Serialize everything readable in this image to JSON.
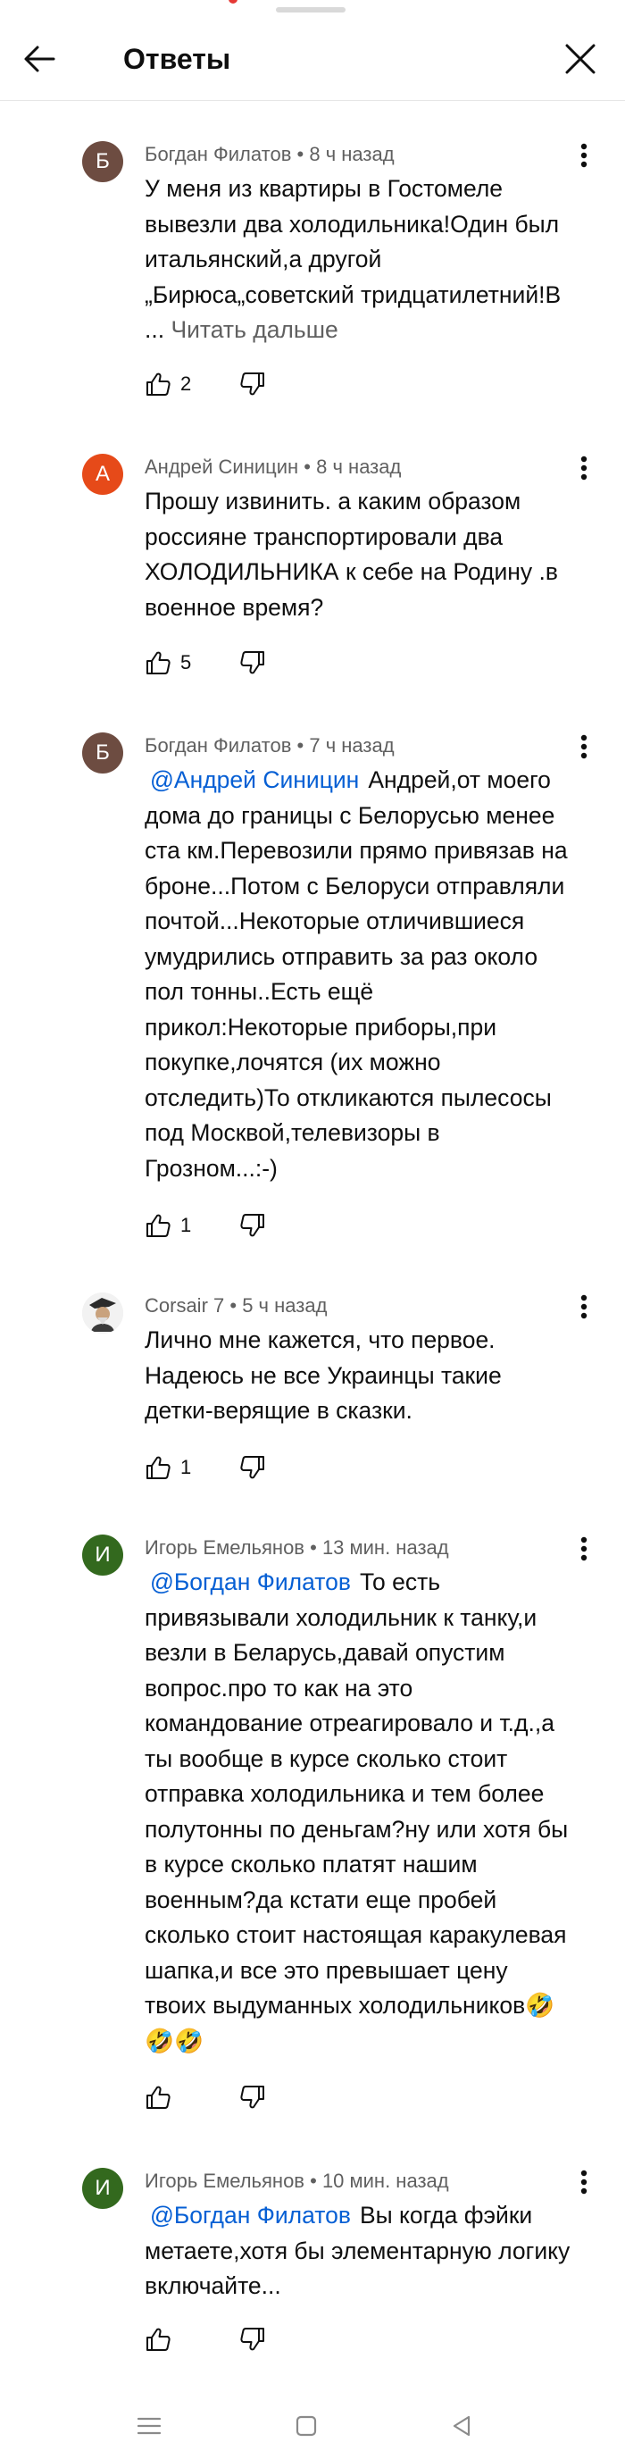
{
  "header": {
    "title": "Ответы"
  },
  "comments": [
    {
      "avatar_letter": "Б",
      "avatar_color": "#6d4c41",
      "author": "Богдан Филатов",
      "time": "8 ч назад",
      "mention": "",
      "text": "У меня из квартиры в Гостомеле вывезли два холодильника!Один был итальянский,а другой „Бирюса„советский тридцатилетний!В ...",
      "read_more": "Читать дальше",
      "likes": "2"
    },
    {
      "avatar_letter": "А",
      "avatar_color": "#e64a19",
      "author": "Андрей Синицин",
      "time": "8 ч назад",
      "mention": "",
      "text": "Прошу извинить. а каким образом россияне транспортировали два ХОЛОДИЛЬНИКА к себе на Родину .в военное время?",
      "read_more": "",
      "likes": "5"
    },
    {
      "avatar_letter": "Б",
      "avatar_color": "#6d4c41",
      "author": "Богдан Филатов",
      "time": "7 ч назад",
      "mention": "@Андрей Синицин",
      "text": "Андрей,от моего дома до границы с Белорусью менее ста км.Перевозили прямо привязав на броне...Потом с Белоруси отправляли почтой...Некоторые отличившиеся умудрились отправить за раз около пол тонны..Есть ещё прикол:Некоторые приборы,при покупке,лочятся (их можно отследить)То откликаются пылесосы под Москвой,телевизоры в Грозном...:-)",
      "read_more": "",
      "likes": "1"
    },
    {
      "avatar_letter": "",
      "avatar_color": "#e0e0e0",
      "author": "Corsair 7",
      "time": "5 ч назад",
      "mention": "",
      "text": "Лично мне кажется, что первое. Надеюсь не все Украинцы такие детки-верящие в сказки.",
      "read_more": "",
      "likes": "1"
    },
    {
      "avatar_letter": "И",
      "avatar_color": "#33691e",
      "author": "Игорь Емельянов",
      "time": "13 мин. назад",
      "mention": "@Богдан Филатов",
      "text": "То есть привязывали холодильник к танку,и везли в Беларусь,давай опустим вопрос.про то как на это командование отреагировало и т.д.,а ты вообще в курсе сколько стоит отправка холодильника и тем более полутонны по деньгам?ну или хотя бы в курсе сколько платят нашим военным?да кстати еще пробей сколько стоит настоящая каракулевая шапка,и все это превышает цену твоих выдуманных холодильников🤣🤣🤣",
      "read_more": "",
      "likes": ""
    },
    {
      "avatar_letter": "И",
      "avatar_color": "#33691e",
      "author": "Игорь Емельянов",
      "time": "10 мин. назад",
      "mention": "@Богдан Филатов",
      "text": "Вы когда фэйки метаете,хотя бы элементарную логику включайте...",
      "read_more": "",
      "likes": ""
    }
  ],
  "icons": {
    "back": "arrow-left-icon",
    "close": "close-icon",
    "more": "more-vert-icon",
    "like": "thumb-up-icon",
    "dislike": "thumb-down-icon",
    "nav_menu": "menu-icon",
    "nav_home": "home-square-icon",
    "nav_back": "triangle-back-icon"
  }
}
